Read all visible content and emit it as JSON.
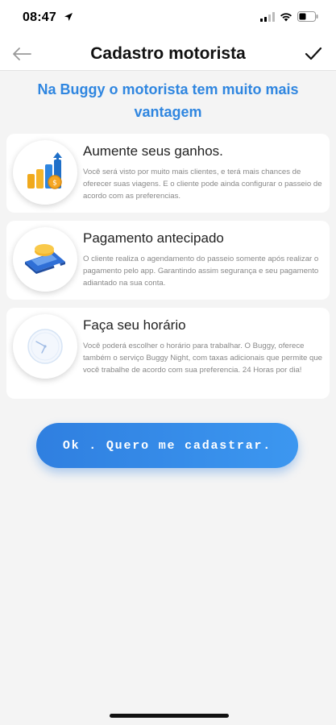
{
  "status_bar": {
    "time": "08:47",
    "icons": [
      "location-arrow-icon",
      "signal-icon",
      "wifi-icon",
      "battery-icon"
    ]
  },
  "nav": {
    "title": "Cadastro motorista",
    "back_icon": "arrow-left-icon",
    "confirm_icon": "checkmark-icon"
  },
  "headline": "Na Buggy o motorista tem muito mais vantagem",
  "cards": [
    {
      "title": "Aumente seus ganhos.",
      "text": "Você será visto por muito mais clientes, e terá mais chances de oferecer suas viagens. E o cliente pode ainda configurar o passeio de acordo com as preferencias.",
      "icon": "coins-growth-icon"
    },
    {
      "title": "Pagamento antecipado",
      "text": "O cliente realiza o agendamento do passeio somente após realizar o pagamento pelo app. Garantindo assim segurança e seu pagamento adiantado na sua conta.",
      "icon": "payment-card-icon"
    },
    {
      "title": "Faça seu horário",
      "text": "Você poderá escolher o horário para trabalhar. O Buggy, oferece também o serviço Buggy Night, com taxas adicionais que permite que você trabalhe de acordo com sua preferencia. 24 Horas por dia!",
      "icon": "clock-icon"
    }
  ],
  "cta_label": "Ok . Quero me cadastrar.",
  "colors": {
    "accent": "#2f86e0",
    "background": "#f4f4f4",
    "card": "#ffffff"
  }
}
